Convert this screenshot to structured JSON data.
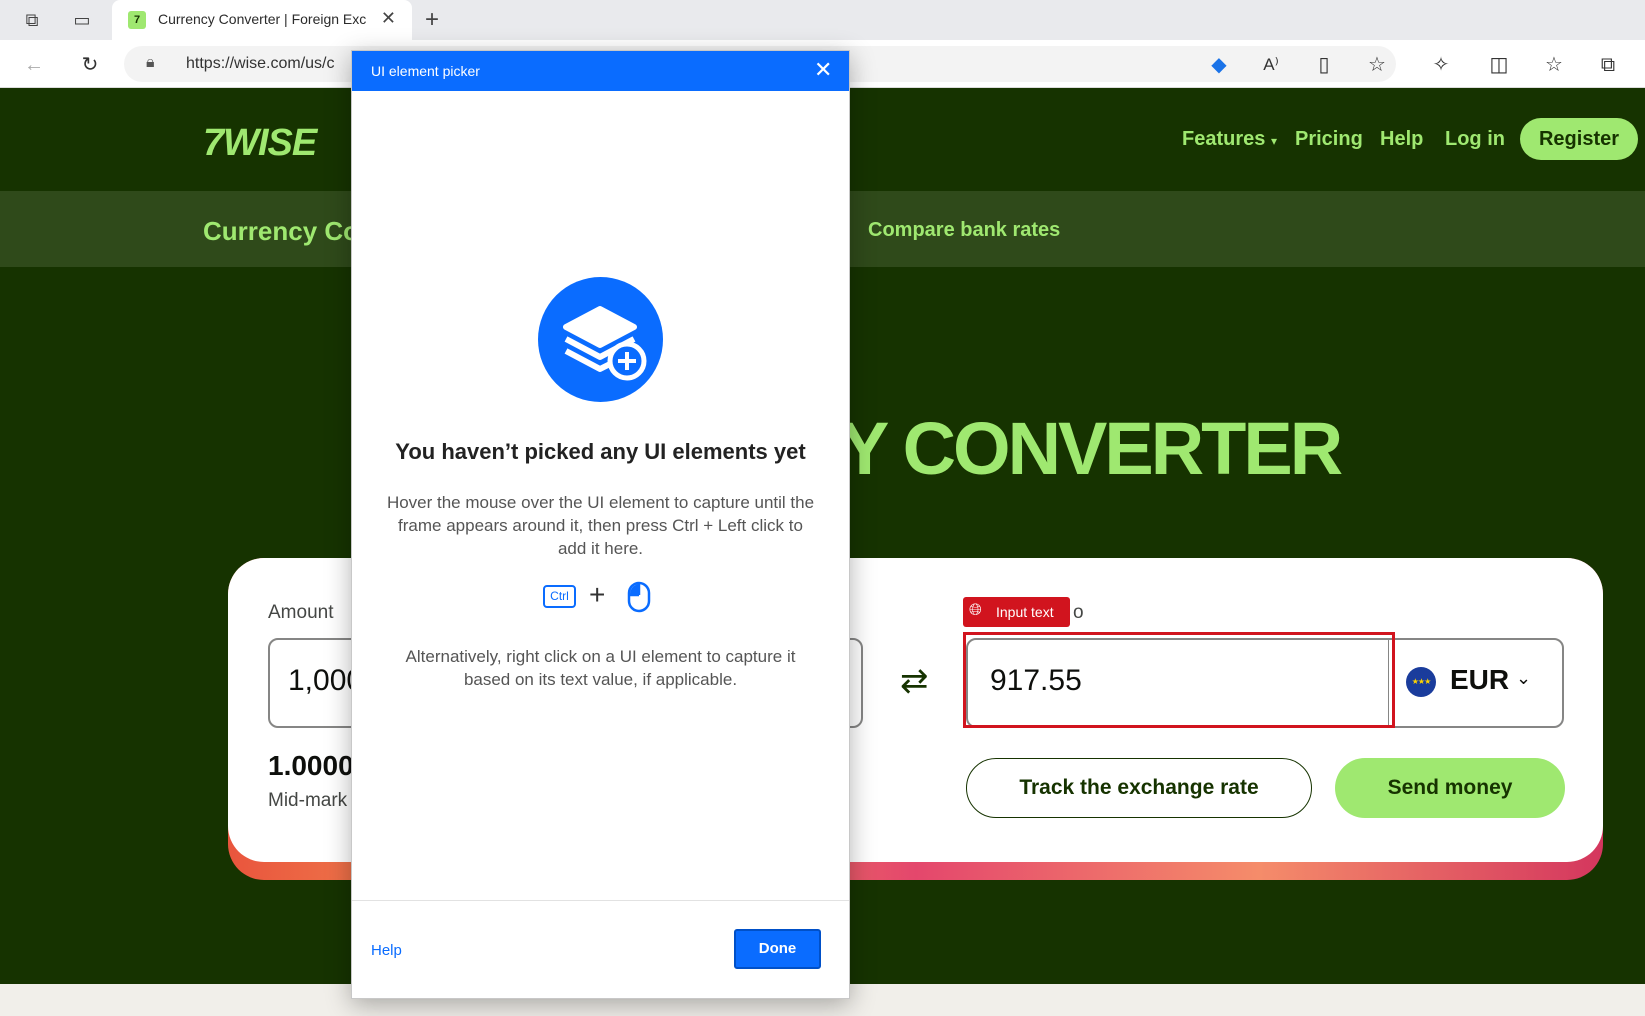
{
  "browser": {
    "tab_title": "Currency Converter | Foreign Exc",
    "tab_favicon": "7",
    "url": "https://wise.com/us/c"
  },
  "site": {
    "logo": "7WISE",
    "nav": [
      "Features",
      "Pricing",
      "Help",
      "Log in"
    ],
    "register": "Register",
    "subnav_title": "Currency Co",
    "compare": "Compare bank rates",
    "heading": "Y CONVERTER"
  },
  "converter": {
    "amount_label": "Amount",
    "amount_value": "1,000",
    "rate_text": "1.0000",
    "midmarket": "Mid-mark",
    "to_label": "o",
    "to_value": "917.55",
    "to_currency": "EUR",
    "track_button": "Track the exchange rate",
    "send_button": "Send money"
  },
  "highlight": {
    "tag": "Input text"
  },
  "dialog": {
    "title": "UI element picker",
    "heading": "You haven’t picked any UI elements yet",
    "instruction": "Hover the mouse over the UI element to capture until the frame appears around it, then press Ctrl + Left click to add it here.",
    "ctrl_key": "Ctrl",
    "alternative": "Alternatively, right click on a UI element to capture it based on its text value, if applicable.",
    "help": "Help",
    "done": "Done"
  },
  "colors": {
    "brand_green": "#9fe870",
    "dark_green": "#163300",
    "dialog_blue": "#0a6cff",
    "highlight_red": "#d1141e"
  }
}
